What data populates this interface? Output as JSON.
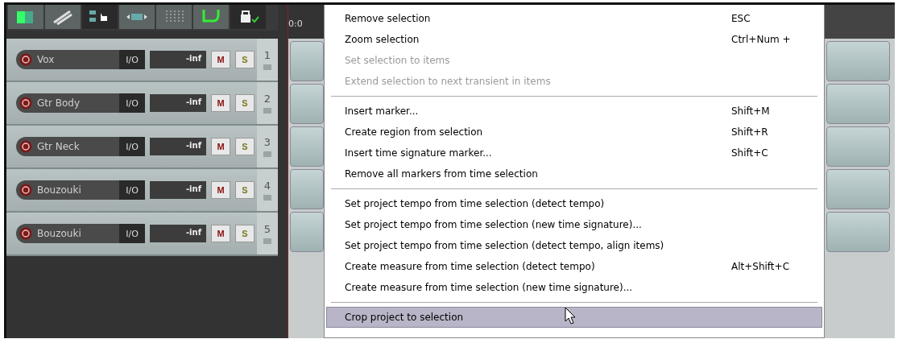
{
  "ruler": {
    "time": "0:0"
  },
  "tracks": [
    {
      "name": "Vox",
      "io": "I/O",
      "volume": "-inf",
      "mute": "M",
      "solo": "S",
      "number": "1"
    },
    {
      "name": "Gtr Body",
      "io": "I/O",
      "volume": "-inf",
      "mute": "M",
      "solo": "S",
      "number": "2"
    },
    {
      "name": "Gtr Neck",
      "io": "I/O",
      "volume": "-inf",
      "mute": "M",
      "solo": "S",
      "number": "3"
    },
    {
      "name": "Bouzouki",
      "io": "I/O",
      "volume": "-inf",
      "mute": "M",
      "solo": "S",
      "number": "4"
    },
    {
      "name": "Bouzouki",
      "io": "I/O",
      "volume": "-inf",
      "mute": "M",
      "solo": "S",
      "number": "5"
    }
  ],
  "menu": [
    {
      "kind": "item",
      "label": "Remove selection",
      "shortcut": "ESC",
      "disabled": false,
      "selected": false
    },
    {
      "kind": "item",
      "label": "Zoom selection",
      "shortcut": "Ctrl+Num +",
      "disabled": false,
      "selected": false
    },
    {
      "kind": "item",
      "label": "Set selection to items",
      "disabled": true,
      "selected": false
    },
    {
      "kind": "item",
      "label": "Extend selection to next transient in items",
      "disabled": true,
      "selected": false
    },
    {
      "kind": "separator"
    },
    {
      "kind": "item",
      "label": "Insert marker...",
      "shortcut": "Shift+M",
      "disabled": false,
      "selected": false
    },
    {
      "kind": "item",
      "label": "Create region from selection",
      "shortcut": "Shift+R",
      "disabled": false,
      "selected": false
    },
    {
      "kind": "item",
      "label": "Insert time signature marker...",
      "shortcut": "Shift+C",
      "disabled": false,
      "selected": false
    },
    {
      "kind": "item",
      "label": "Remove all markers from time selection",
      "disabled": false,
      "selected": false
    },
    {
      "kind": "separator"
    },
    {
      "kind": "item",
      "label": "Set project tempo from time selection (detect tempo)",
      "disabled": false,
      "selected": false
    },
    {
      "kind": "item",
      "label": "Set project tempo from time selection (new time signature)...",
      "disabled": false,
      "selected": false
    },
    {
      "kind": "item",
      "label": "Set project tempo from time selection (detect tempo, align items)",
      "disabled": false,
      "selected": false
    },
    {
      "kind": "item",
      "label": "Create measure from time selection (detect tempo)",
      "shortcut": "Alt+Shift+C",
      "disabled": false,
      "selected": false
    },
    {
      "kind": "item",
      "label": "Create measure from time selection (new time signature)...",
      "disabled": false,
      "selected": false
    },
    {
      "kind": "separator"
    },
    {
      "kind": "item",
      "label": "Crop project to selection",
      "disabled": false,
      "selected": true
    }
  ]
}
